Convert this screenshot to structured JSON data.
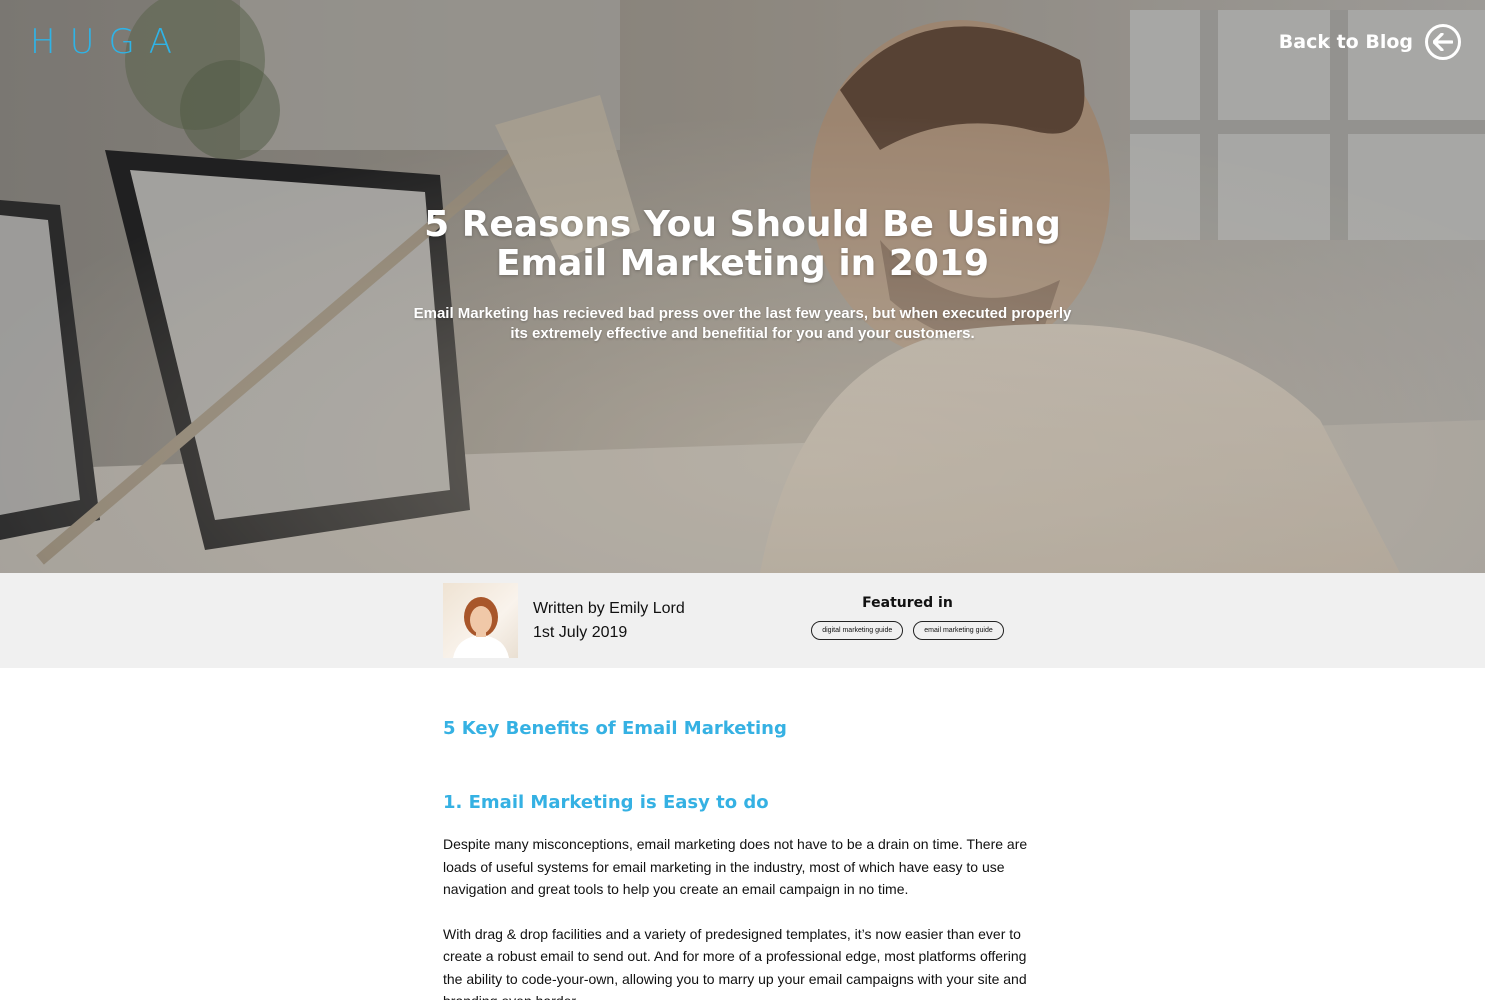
{
  "header": {
    "logo": "HUGA",
    "back_label": "Back to Blog"
  },
  "hero": {
    "title_line1": "5 Reasons You Should Be Using",
    "title_line2": "Email Marketing in 2019",
    "subtitle": "Email Marketing has recieved bad press over the last few years, but when executed properly its extremely effective and benefitial for you and your customers."
  },
  "meta": {
    "author": "Written by Emily Lord",
    "date": "1st July 2019",
    "featured_label": "Featured in",
    "tags": [
      "digital marketing guide",
      "email marketing guide"
    ]
  },
  "article": {
    "heading": "5 Key Benefits of Email Marketing",
    "section1_heading": "1. Email Marketing is Easy to do",
    "paragraph1": "Despite many misconceptions, email marketing does not have to be a drain on time. There are loads of useful systems for email marketing in the industry, most of which have easy to use navigation and great tools to help you create an email campaign in no time.",
    "paragraph2": "With drag & drop facilities and a variety of predesigned templates, it’s now easier than ever to create a robust email to send out. And for more of a professional edge, most platforms offering the ability to code-your-own, allowing you to marry up your email campaigns with your site and branding even harder."
  },
  "colors": {
    "accent": "#35b1e3",
    "meta_bar_bg": "#f0f0f0"
  },
  "icons": {
    "back": "arrow-left-circle-icon"
  }
}
